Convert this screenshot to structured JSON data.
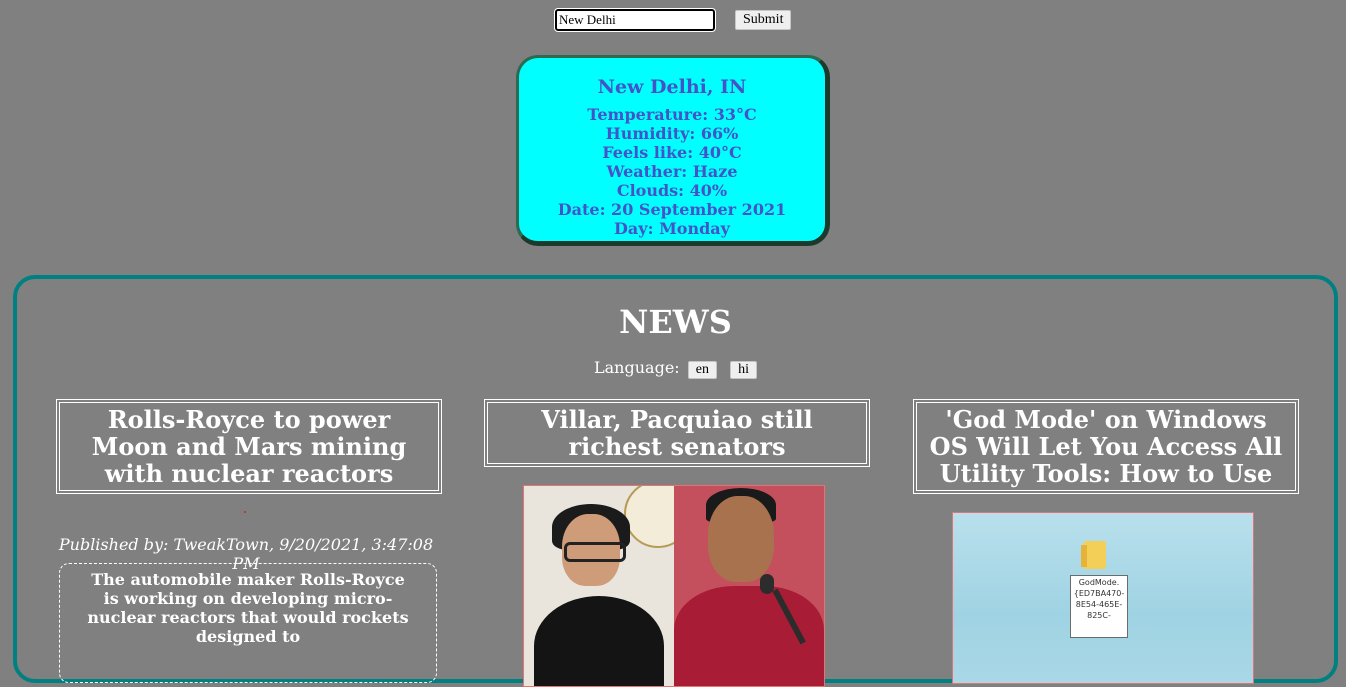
{
  "search": {
    "value": "New Delhi",
    "submit_label": "Submit"
  },
  "weather": {
    "city": "New Delhi, IN",
    "temperature": "Temperature: 33°C",
    "humidity": "Humidity: 66%",
    "feels_like": "Feels like: 40°C",
    "condition": "Weather: Haze",
    "clouds": "Clouds: 40%",
    "date": "Date: 20 September 2021",
    "day": "Day: Monday"
  },
  "news": {
    "title": "NEWS",
    "language_label": "Language:",
    "languages": [
      "en",
      "hi"
    ],
    "articles": [
      {
        "headline": "Rolls-Royce to power Moon and Mars mining with nuclear reactors",
        "published": "Published by: TweakTown, 9/20/2021, 3:47:08 PM",
        "summary": "The automobile maker Rolls-Royce is working on developing micro-nuclear reactors that would rockets designed to"
      },
      {
        "headline": "Villar, Pacquiao still richest senators"
      },
      {
        "headline": "'God Mode' on Windows OS Will Let You Access All Utility Tools: How to Use",
        "image_caption": "GodMode.{ED7BA470-8E54-465E-825C-"
      }
    ]
  },
  "colors": {
    "background": "#808080",
    "weather_card": "#00ffff",
    "weather_text": "#4453c8",
    "news_border": "#008080"
  }
}
